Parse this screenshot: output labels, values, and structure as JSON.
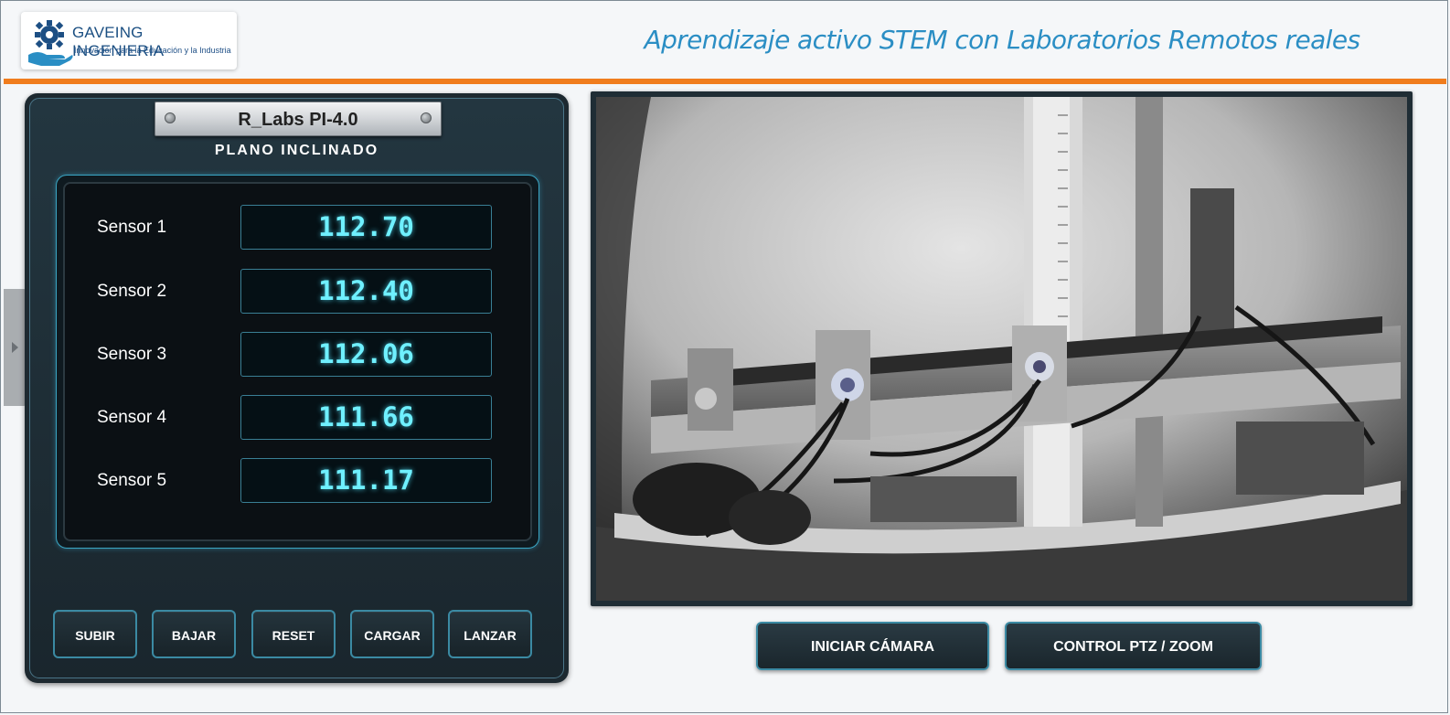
{
  "header": {
    "logo_name": "GAVEING  INGENIERIA",
    "logo_tagline": "Innovación para la Educación y la Industria",
    "title": "Aprendizaje activo STEM con Laboratorios Remotos reales"
  },
  "panel": {
    "nameplate": "R_Labs PI-4.0",
    "subtitle": "PLANO INCLINADO",
    "sensors": [
      {
        "label": "Sensor 1",
        "value": "112.70"
      },
      {
        "label": "Sensor 2",
        "value": "112.40"
      },
      {
        "label": "Sensor 3",
        "value": "112.06"
      },
      {
        "label": "Sensor 4",
        "value": "111.66"
      },
      {
        "label": "Sensor 5",
        "value": "111.17"
      }
    ],
    "buttons": [
      "SUBIR",
      "BAJAR",
      "RESET",
      "CARGAR",
      "LANZAR"
    ]
  },
  "camera": {
    "start_label": "INICIAR CÁMARA",
    "ptz_label": "CONTROL PTZ / ZOOM"
  },
  "colors": {
    "accent_orange": "#f07d1e",
    "title_blue": "#2b8ec4",
    "panel_dark": "#1d2930",
    "digit_cyan": "#6ff0ff"
  },
  "icons": [
    "gear-hand-logo-icon",
    "chevron-right-icon"
  ]
}
